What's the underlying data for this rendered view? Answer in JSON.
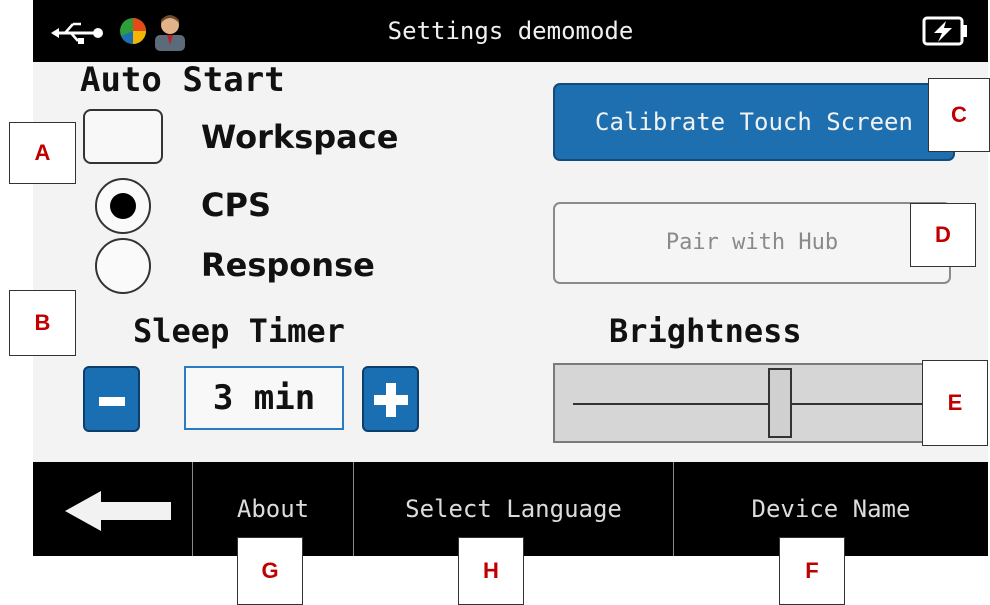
{
  "status_bar": {
    "title": "Settings demomode",
    "icons": [
      "usb-icon",
      "pie-chart-icon",
      "user-icon",
      "battery-charging-icon"
    ]
  },
  "auto_start": {
    "heading": "Auto Start",
    "checkbox_label": "Workspace",
    "checkbox_checked": false,
    "options": [
      {
        "label": "CPS",
        "selected": true
      },
      {
        "label": "Response",
        "selected": false
      }
    ]
  },
  "sleep_timer": {
    "heading": "Sleep Timer",
    "value": "3 min"
  },
  "buttons": {
    "calibrate": "Calibrate Touch Screen",
    "pair": "Pair with Hub"
  },
  "brightness": {
    "heading": "Brightness",
    "level": 0.56
  },
  "nav": {
    "about": "About",
    "language": "Select Language",
    "device_name": "Device Name"
  },
  "callouts": {
    "a": "A",
    "b": "B",
    "c": "C",
    "d": "D",
    "e": "E",
    "f": "F",
    "g": "G",
    "h": "H"
  },
  "colors": {
    "accent": "#1e6fb0",
    "bar": "#000000",
    "callout_text": "#c00000"
  }
}
